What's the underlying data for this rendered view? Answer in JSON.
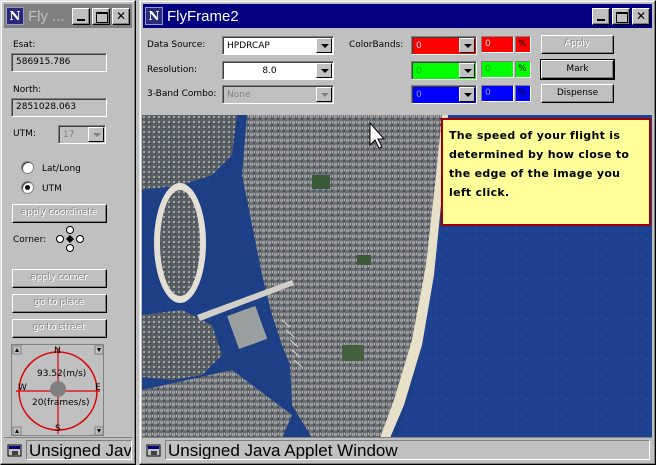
{
  "left_window": {
    "title": "Fly ...",
    "esat_label": "Esat:",
    "esat_value": "586915.786",
    "north_label": "North:",
    "north_value": "2851028.063",
    "utm_label": "UTM:",
    "utm_value": "17",
    "radio_latlong": "Lat/Long",
    "radio_utm": "UTM",
    "selected_radio": "UTM",
    "apply_coordinate": "apply coordinate",
    "corner_label": "Corner:",
    "apply_corner": "apply corner",
    "go_to_place": "go to place",
    "go_to_street": "go to street",
    "compass": {
      "north": "N",
      "west": "W",
      "east": "E",
      "south": "S",
      "speed": "93.52(m/s)",
      "frame_rate": "20(frames/s)"
    },
    "status": "Unsigned Java Applet Window"
  },
  "main_window": {
    "title": "FlyFrame2",
    "data_source_label": "Data Source:",
    "data_source_value": "HPDRCAP",
    "resolution_label": "Resolution:",
    "resolution_value": "8.0",
    "band_combo_label": "3-Band Combo:",
    "band_combo_value": "None",
    "colorbands_label": "ColorBands:",
    "bands": [
      {
        "name": "red",
        "value": "0",
        "pct_value": "0",
        "pct_sign": "%",
        "color": "#ff0000"
      },
      {
        "name": "green",
        "value": "0",
        "pct_value": "0",
        "pct_sign": "%",
        "color": "#00ff00"
      },
      {
        "name": "blue",
        "value": "0",
        "pct_value": "0",
        "pct_sign": "%",
        "color": "#0000ff"
      }
    ],
    "apply_button": "Apply",
    "mark_button": "Mark",
    "dispense_button": "Dispense",
    "tooltip": "The speed of your flight is determined by how close to the edge of the image you left click.",
    "status": "Unsigned Java Applet Window"
  },
  "colors": {
    "title_active": "#000080",
    "title_inactive": "#808080",
    "tooltip_bg": "#ffff99",
    "tooltip_border": "#a00000",
    "compass_red": "#dd0000"
  }
}
